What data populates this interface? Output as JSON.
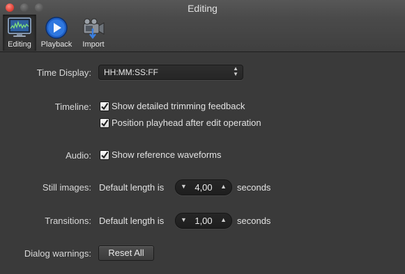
{
  "window": {
    "title": "Editing"
  },
  "toolbar": {
    "items": [
      {
        "label": "Editing",
        "icon": "editing-monitor-icon",
        "selected": true
      },
      {
        "label": "Playback",
        "icon": "play-icon",
        "selected": false
      },
      {
        "label": "Import",
        "icon": "camera-import-icon",
        "selected": false
      }
    ]
  },
  "settings": {
    "time_display": {
      "label": "Time Display:",
      "value": "HH:MM:SS:FF"
    },
    "timeline": {
      "label": "Timeline:",
      "options": [
        {
          "text": "Show detailed trimming feedback",
          "checked": true
        },
        {
          "text": "Position playhead after edit operation",
          "checked": true
        }
      ]
    },
    "audio": {
      "label": "Audio:",
      "options": [
        {
          "text": "Show reference waveforms",
          "checked": true
        }
      ]
    },
    "still_images": {
      "label": "Still images:",
      "prefix": "Default length is",
      "value": "4,00",
      "unit": "seconds"
    },
    "transitions": {
      "label": "Transitions:",
      "prefix": "Default length is",
      "value": "1,00",
      "unit": "seconds"
    },
    "dialog_warnings": {
      "label": "Dialog warnings:",
      "button": "Reset All"
    }
  },
  "colors": {
    "accent": "#2f6fd6",
    "close": "#e0443a",
    "background": "#3a3a3a"
  }
}
